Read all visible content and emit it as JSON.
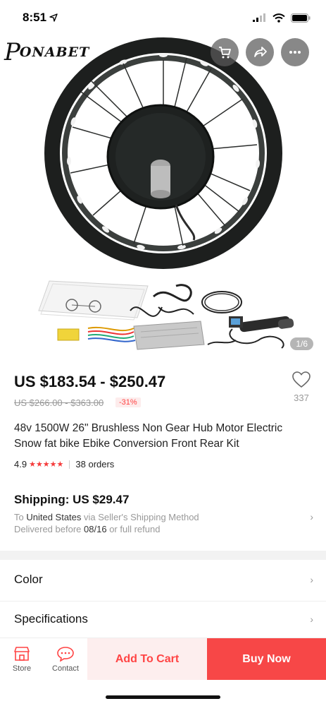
{
  "status_bar": {
    "time": "8:51"
  },
  "gallery": {
    "brand": "ONABET",
    "brand_initial": "P",
    "counter": "1/6"
  },
  "price": {
    "current_range": "US $183.54 - $250.47",
    "original_range": "US $266.00 - $363.00",
    "discount": "-31%",
    "wishlist_count": "337"
  },
  "product": {
    "title": "48v 1500W  26\" Brushless Non Gear Hub Motor Electric Snow fat bike Ebike Conversion Front Rear Kit",
    "rating": "4.9",
    "stars": "★★★★★",
    "orders": "38 orders"
  },
  "shipping": {
    "title": "Shipping: US $29.47",
    "to_prefix": "To",
    "destination": "United States",
    "method": "via Seller's Shipping Method",
    "delivered_prefix": "Delivered before",
    "delivery_date": "08/16",
    "delivery_suffix": "or full refund"
  },
  "rows": {
    "color": "Color",
    "specifications": "Specifications"
  },
  "bottom_bar": {
    "store": "Store",
    "contact": "Contact",
    "add_to_cart": "Add To Cart",
    "buy_now": "Buy Now"
  },
  "colors": {
    "accent": "#f74747",
    "add_cart_bg": "#fdeeee",
    "muted": "#999999"
  },
  "icons": [
    "location-arrow-icon",
    "signal-icon",
    "wifi-icon",
    "battery-icon",
    "cart-icon",
    "share-icon",
    "more-icon",
    "heart-icon",
    "chevron-right-icon",
    "store-icon",
    "chat-icon"
  ]
}
